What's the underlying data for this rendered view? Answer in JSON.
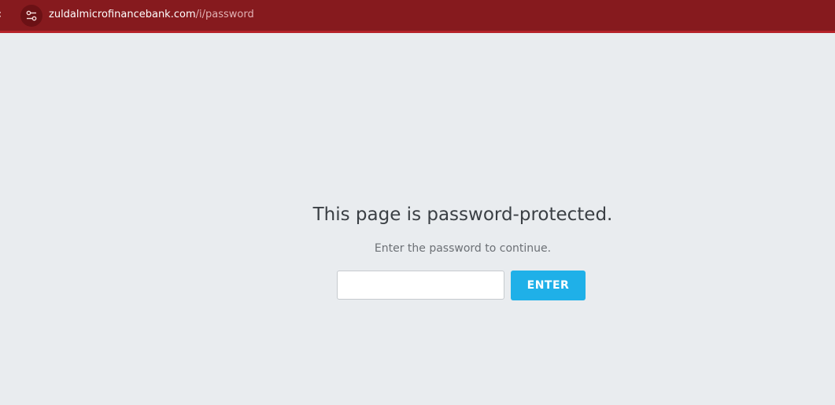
{
  "browser": {
    "url_host": "zuldalmicrofinancebank.com",
    "url_path": "/i/password",
    "back_icon": "chevron-left-icon",
    "site_info_icon": "tune-icon"
  },
  "main": {
    "heading": "This page is password-protected.",
    "subtext": "Enter the password to continue.",
    "password_value": "",
    "enter_label": "ENTER"
  },
  "colors": {
    "topbar": "#861a1e",
    "button": "#1fb0e8",
    "background": "#e9ecef"
  }
}
